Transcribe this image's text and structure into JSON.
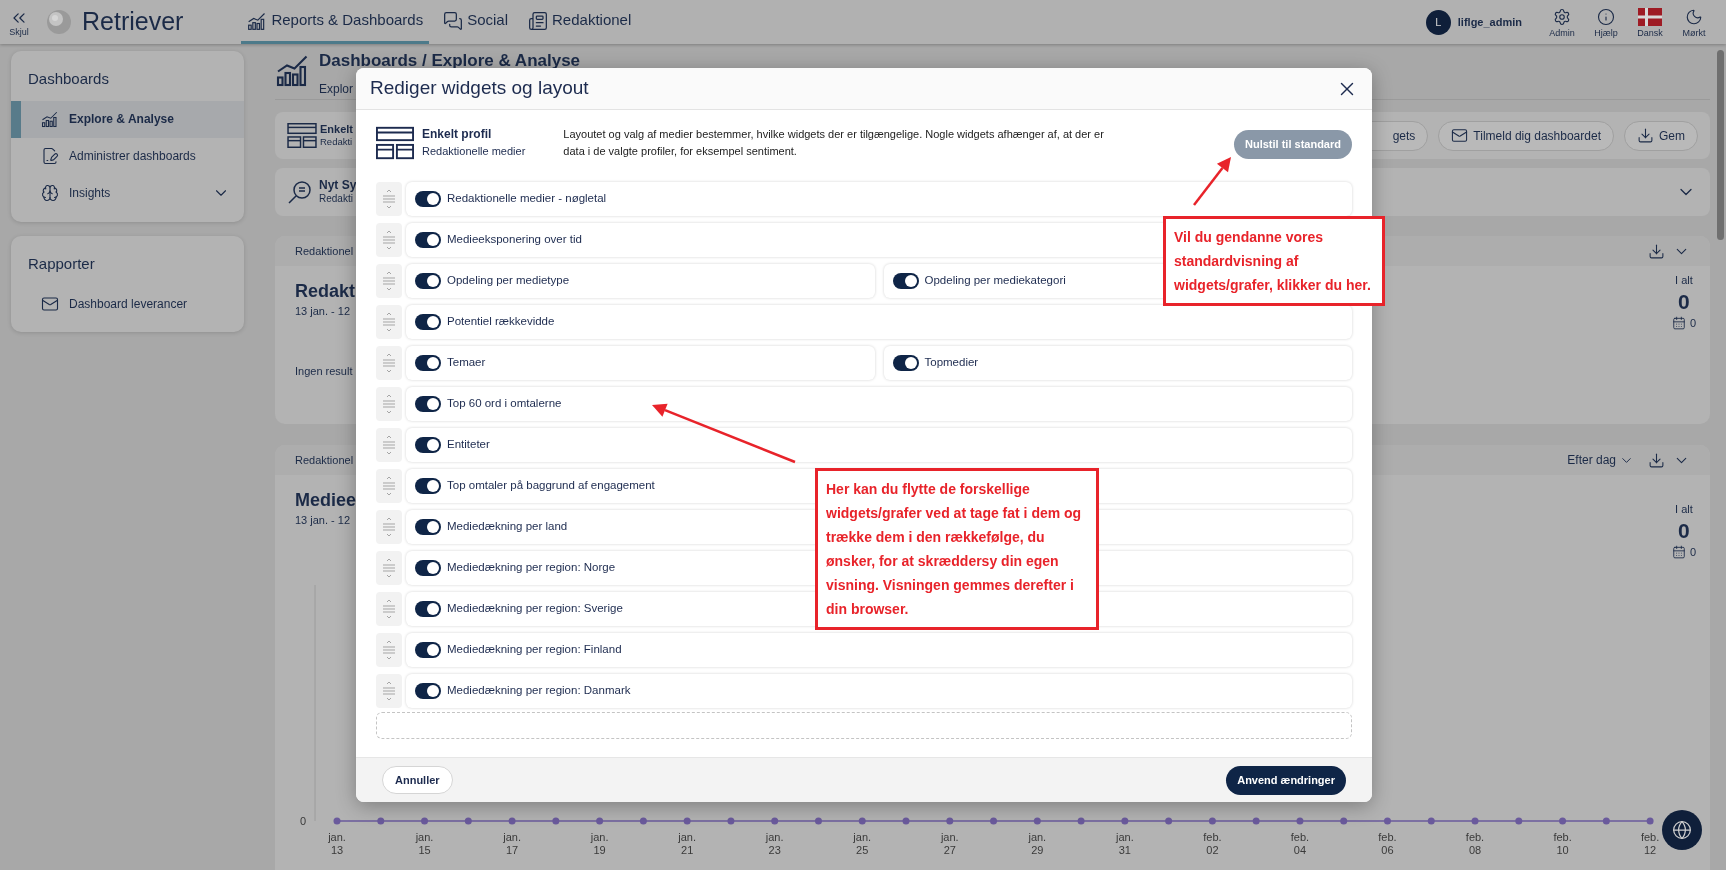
{
  "topbar": {
    "collapse_label": "Skjul",
    "logo": "Retriever",
    "tabs": [
      {
        "label": "Reports & Dashboards",
        "selected": true
      },
      {
        "label": "Social",
        "selected": false
      },
      {
        "label": "Redaktionel",
        "selected": false
      }
    ],
    "user": {
      "initial": "L",
      "name": "liflge_admin"
    },
    "actions": [
      {
        "label": "Admin"
      },
      {
        "label": "Hjælp"
      },
      {
        "label": "Dansk"
      },
      {
        "label": "Mørkt"
      }
    ]
  },
  "sidebar": {
    "sections": [
      {
        "title": "Dashboards",
        "items": [
          {
            "label": "Explore & Analyse",
            "selected": true
          },
          {
            "label": "Administrer dashboards",
            "selected": false
          },
          {
            "label": "Insights",
            "selected": false,
            "expanded": false
          }
        ]
      },
      {
        "title": "Rapporter",
        "items": [
          {
            "label": "Dashboard leverancer",
            "selected": false
          }
        ]
      }
    ]
  },
  "page": {
    "title": "Dashboards / Explore & Analyse",
    "subtitle": "Explor",
    "profile_bar": {
      "name": "Enkelt",
      "sub": "Redakti",
      "buttons": [
        {
          "label": "gets"
        },
        {
          "label": "Tilmeld dig dashboardet"
        },
        {
          "label": "Gem"
        }
      ]
    },
    "search_bar": {
      "name": "Nyt Sy",
      "sub": "Redakti"
    },
    "cards": [
      {
        "header": "Redaktionel",
        "title": "Redakt",
        "date": "13 jan. - 12",
        "empty_text": "Ingen result",
        "total_label": "I alt",
        "total": "0",
        "sub_total": "0"
      },
      {
        "header": "Redaktionel",
        "title": "Mediee",
        "date": "13 jan. - 12",
        "dropdown": "Efter dag",
        "total_label": "I alt",
        "total": "0",
        "sub_total": "0",
        "chart": {
          "y_label": "0",
          "x_labels": [
            "jan. 13",
            "jan. 15",
            "jan. 17",
            "jan. 19",
            "jan. 21",
            "jan. 23",
            "jan. 25",
            "jan. 27",
            "jan. 29",
            "jan. 31",
            "feb. 02",
            "feb. 04",
            "feb. 06",
            "feb. 08",
            "feb. 10",
            "feb. 12"
          ]
        }
      }
    ]
  },
  "modal": {
    "title": "Rediger widgets og layout",
    "profile": {
      "name": "Enkelt profil",
      "sub": "Redaktionelle medier"
    },
    "description": "Layoutet og valg af medier bestemmer, hvilke widgets der er tilgængelige. Nogle widgets afhænger af, at der er data i de valgte profiler, for eksempel sentiment.",
    "reset_button": "Nulstil til standard",
    "rows": [
      {
        "widgets": [
          {
            "label": "Redaktionelle medier - nøgletal",
            "on": true
          }
        ]
      },
      {
        "widgets": [
          {
            "label": "Medieeksponering over tid",
            "on": true
          }
        ]
      },
      {
        "widgets": [
          {
            "label": "Opdeling per medietype",
            "on": true
          },
          {
            "label": "Opdeling per mediekategori",
            "on": true
          }
        ]
      },
      {
        "widgets": [
          {
            "label": "Potentiel rækkevidde",
            "on": true
          }
        ]
      },
      {
        "widgets": [
          {
            "label": "Temaer",
            "on": true
          },
          {
            "label": "Topmedier",
            "on": true
          }
        ]
      },
      {
        "widgets": [
          {
            "label": "Top 60 ord i omtalerne",
            "on": true
          }
        ]
      },
      {
        "widgets": [
          {
            "label": "Entiteter",
            "on": true
          }
        ]
      },
      {
        "widgets": [
          {
            "label": "Top omtaler på baggrund af engagement",
            "on": true
          }
        ]
      },
      {
        "widgets": [
          {
            "label": "Mediedækning per land",
            "on": true
          }
        ]
      },
      {
        "widgets": [
          {
            "label": "Mediedækning per region: Norge",
            "on": true
          }
        ]
      },
      {
        "widgets": [
          {
            "label": "Mediedækning per region: Sverige",
            "on": true
          }
        ]
      },
      {
        "widgets": [
          {
            "label": "Mediedækning per region: Finland",
            "on": true
          }
        ]
      },
      {
        "widgets": [
          {
            "label": "Mediedækning per region: Danmark",
            "on": true
          }
        ]
      }
    ],
    "cancel_button": "Annuller",
    "apply_button": "Anvend ændringer"
  },
  "annotations": [
    {
      "text": "Vil du gendanne vores standardvisning af widgets/grafer, klikker du her."
    },
    {
      "text": "Her kan du flytte de forskellige widgets/grafer ved at tage fat i dem og trække dem i den rækkefølge, du ønsker, for at skræddersy din egen visning. Visningen gemmes derefter i din browser."
    }
  ]
}
